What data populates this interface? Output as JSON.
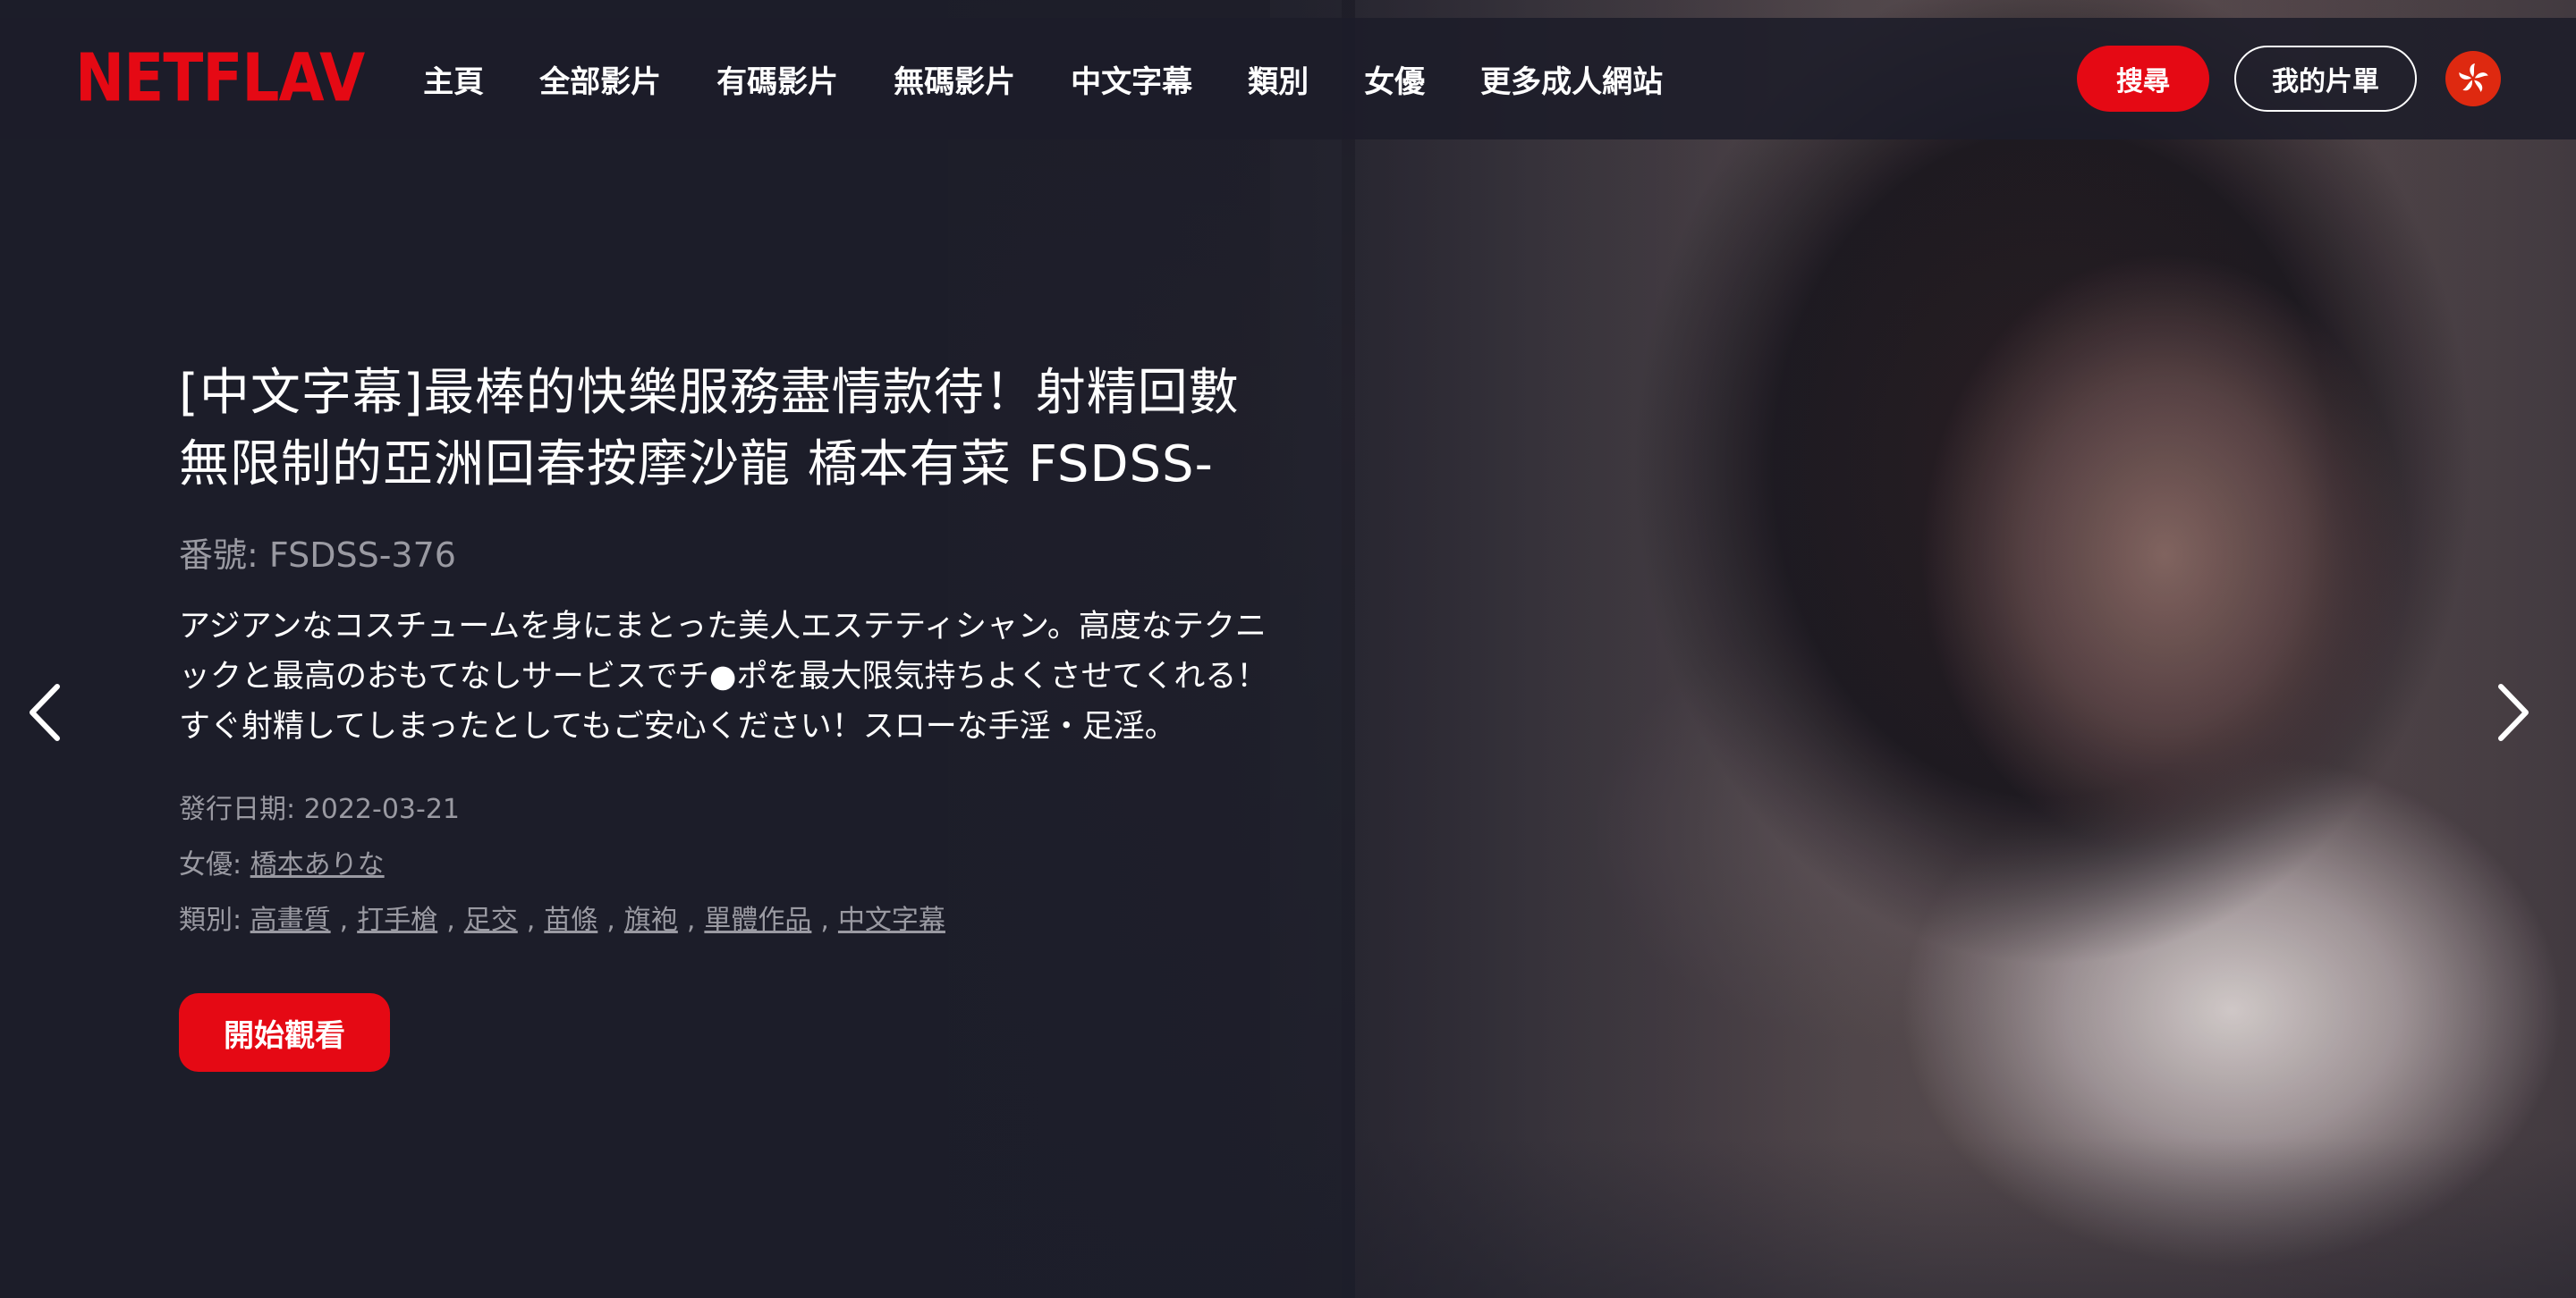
{
  "brand": {
    "logo_text": "NETFLAV",
    "accent_color": "#e50914"
  },
  "nav": {
    "items": [
      {
        "label": "主頁"
      },
      {
        "label": "全部影片"
      },
      {
        "label": "有碼影片"
      },
      {
        "label": "無碼影片"
      },
      {
        "label": "中文字幕"
      },
      {
        "label": "類別"
      },
      {
        "label": "女優"
      },
      {
        "label": "更多成人網站"
      }
    ],
    "search_label": "搜尋",
    "mylist_label": "我的片單",
    "region_icon": "hong-kong-flag-icon"
  },
  "hero": {
    "title": "[中文字幕]最棒的快樂服務盡情款待！射精回數無限制的亞洲回春按摩沙龍 橋本有菜 FSDSS-",
    "code_label": "番號:",
    "code_value": "FSDSS-376",
    "description": "アジアンなコスチュームを身にまとった美人エステティシャン。高度なテクニックと最高のおもてなしサービスでチ●ポを最大限気持ちよくさせてくれる！すぐ射精してしまったとしてもご安心ください！スローな手淫・足淫。",
    "release_label": "發行日期:",
    "release_date": "2022-03-21",
    "actress_label": "女優:",
    "actress": "橋本ありな",
    "genre_label": "類別:",
    "genres": [
      "高畫質",
      "打手槍",
      "足交",
      "苗條",
      "旗袍",
      "單體作品",
      "中文字幕"
    ],
    "genre_separator": ",",
    "watch_label": "開始觀看"
  },
  "carousel": {
    "prev_icon": "chevron-left-icon",
    "next_icon": "chevron-right-icon"
  },
  "colors": {
    "background": "#1c1d29",
    "muted_text": "#9a9aa2"
  }
}
